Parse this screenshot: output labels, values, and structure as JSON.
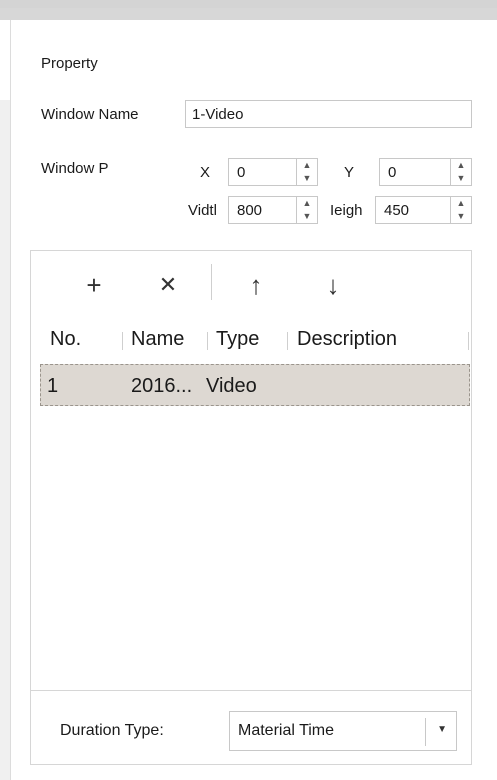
{
  "panel": {
    "title": "Property",
    "window_name_label": "Window Name",
    "window_name_value": "1-Video",
    "window_position_label": "Window P",
    "x_label": "X",
    "x_value": "0",
    "y_label": "Y",
    "y_value": "0",
    "width_label": "Vidtl",
    "width_value": "800",
    "height_label": "Ieigh",
    "height_value": "450"
  },
  "toolbar": {
    "add_glyph": "+",
    "delete_glyph": "✕",
    "up_glyph": "↑",
    "down_glyph": "↓"
  },
  "table": {
    "columns": [
      "No.",
      "Name",
      "Type",
      "Description"
    ],
    "rows": [
      {
        "no": "1",
        "name": "2016...",
        "type": "Video",
        "description": ""
      }
    ]
  },
  "footer": {
    "duration_label": "Duration Type:",
    "duration_value": "Material Time"
  },
  "icons": {
    "spin_up": "▲",
    "spin_down": "▼",
    "dropdown_arrow": "▼"
  }
}
